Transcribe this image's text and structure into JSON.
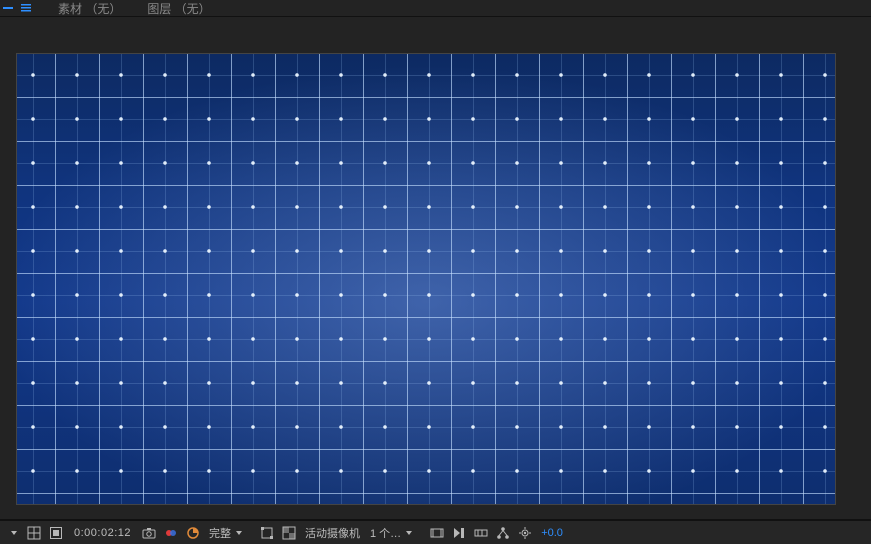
{
  "top": {
    "menu_footage": "素材 （无）",
    "menu_layer": "图层 （无）"
  },
  "toolbar": {
    "timecode": "0:00:02:12",
    "quality_label": "完整",
    "camera_label": "活动摄像机",
    "views_label": "1 个…",
    "exposure": "+0.0"
  }
}
